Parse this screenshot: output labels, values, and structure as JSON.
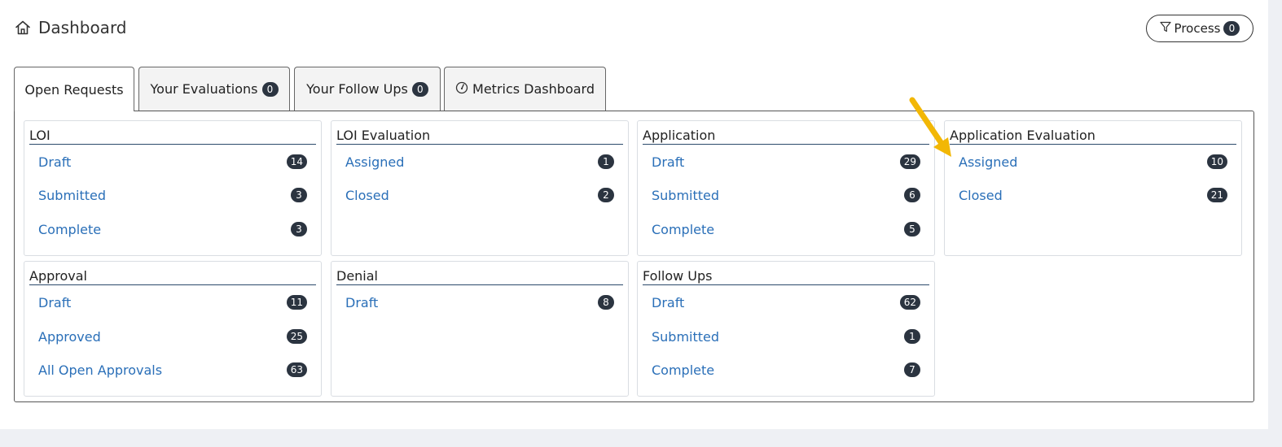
{
  "header": {
    "title": "Dashboard",
    "icon": "home-icon"
  },
  "process_button": {
    "label": "Process",
    "count": "0",
    "icon": "filter-icon"
  },
  "tabs": [
    {
      "label": "Open Requests",
      "active": true
    },
    {
      "label": "Your Evaluations",
      "count": "0"
    },
    {
      "label": "Your Follow Ups",
      "count": "0"
    },
    {
      "label": "Metrics Dashboard",
      "icon": "gauge-icon"
    }
  ],
  "cards": [
    {
      "title": "LOI",
      "items": [
        {
          "label": "Draft",
          "count": "14"
        },
        {
          "label": "Submitted",
          "count": "3"
        },
        {
          "label": "Complete",
          "count": "3"
        }
      ]
    },
    {
      "title": "LOI Evaluation",
      "items": [
        {
          "label": "Assigned",
          "count": "1"
        },
        {
          "label": "Closed",
          "count": "2"
        }
      ]
    },
    {
      "title": "Application",
      "items": [
        {
          "label": "Draft",
          "count": "29"
        },
        {
          "label": "Submitted",
          "count": "6"
        },
        {
          "label": "Complete",
          "count": "5"
        }
      ]
    },
    {
      "title": "Application Evaluation",
      "items": [
        {
          "label": "Assigned",
          "count": "10"
        },
        {
          "label": "Closed",
          "count": "21"
        }
      ]
    },
    {
      "title": "Approval",
      "items": [
        {
          "label": "Draft",
          "count": "11"
        },
        {
          "label": "Approved",
          "count": "25"
        },
        {
          "label": "All Open Approvals",
          "count": "63"
        }
      ]
    },
    {
      "title": "Denial",
      "items": [
        {
          "label": "Draft",
          "count": "8"
        }
      ]
    },
    {
      "title": "Follow Ups",
      "items": [
        {
          "label": "Draft",
          "count": "62"
        },
        {
          "label": "Submitted",
          "count": "1"
        },
        {
          "label": "Complete",
          "count": "7"
        }
      ]
    }
  ],
  "colors": {
    "link": "#2a6fb8",
    "badge": "#2b3440",
    "annotation_arrow": "#f2b705"
  }
}
